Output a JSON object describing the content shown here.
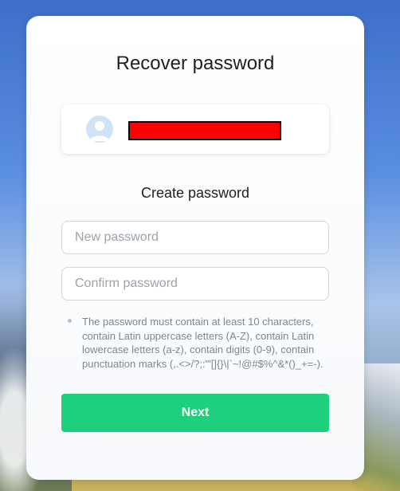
{
  "page": {
    "title": "Recover password",
    "subtitle": "Create password"
  },
  "account": {
    "avatar_icon": "user-avatar-icon",
    "name_redacted": true
  },
  "form": {
    "new_password": {
      "placeholder": "New password",
      "value": ""
    },
    "confirm_password": {
      "placeholder": "Confirm password",
      "value": ""
    },
    "hint": "The password must contain at least 10 characters, contain Latin uppercase letters (A-Z), contain Latin lowercase letters (a-z), contain digits (0-9), contain punctuation marks (,.<>/?;:'\"[]{}\\|`~!@#$%^&*()_+=-).",
    "submit_label": "Next"
  },
  "colors": {
    "accent": "#1ecf7d",
    "redaction": "#ff0000",
    "avatar_bg": "#cfe3f7",
    "avatar_fg": "#ffffff"
  }
}
